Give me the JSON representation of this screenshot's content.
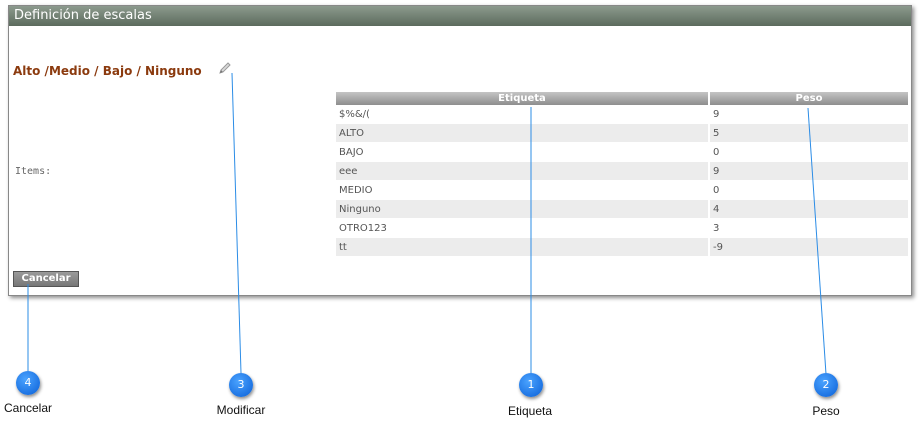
{
  "window": {
    "title": "Definición de escalas"
  },
  "scale": {
    "name": "Alto /Medio / Bajo / Ninguno",
    "edit_icon": "pencil-icon"
  },
  "items": {
    "label": "Items:",
    "headers": {
      "etiqueta": "Etiqueta",
      "peso": "Peso"
    },
    "rows": [
      {
        "etiqueta": "$%&/(",
        "peso": "9"
      },
      {
        "etiqueta": "ALTO",
        "peso": "5"
      },
      {
        "etiqueta": "BAJO",
        "peso": "0"
      },
      {
        "etiqueta": "eee",
        "peso": "9"
      },
      {
        "etiqueta": "MEDIO",
        "peso": "0"
      },
      {
        "etiqueta": "Ninguno",
        "peso": "4"
      },
      {
        "etiqueta": "OTRO123",
        "peso": "3"
      },
      {
        "etiqueta": "tt",
        "peso": "-9"
      }
    ]
  },
  "buttons": {
    "cancel": "Cancelar"
  },
  "callouts": [
    {
      "num": "1",
      "label": "Etiqueta"
    },
    {
      "num": "2",
      "label": "Peso"
    },
    {
      "num": "3",
      "label": "Modificar"
    },
    {
      "num": "4",
      "label": "Cancelar"
    }
  ],
  "colors": {
    "accent": "#1a7be8",
    "title_text": "#8b3a0e"
  }
}
